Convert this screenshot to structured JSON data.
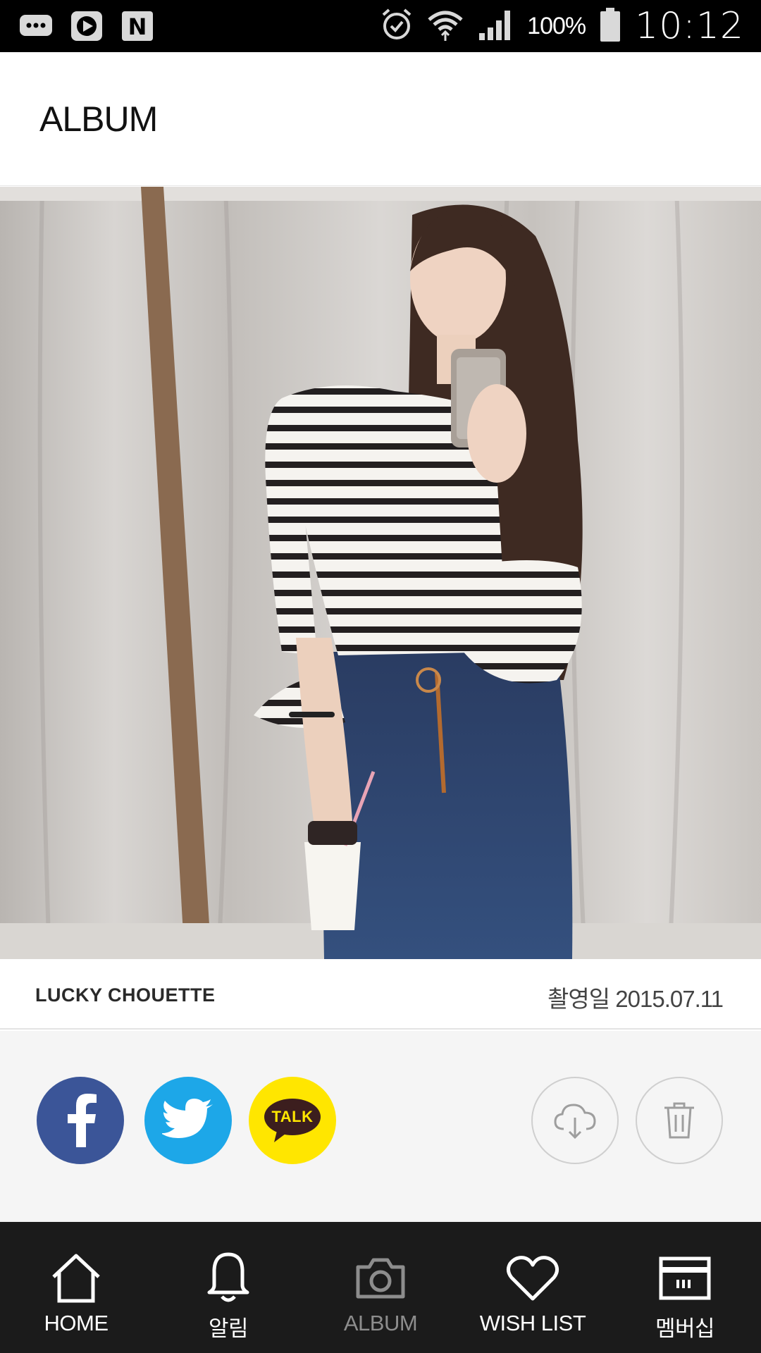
{
  "status_bar": {
    "icons": [
      "chat-bubble-icon",
      "play-icon",
      "naver-n-icon",
      "alarm-icon",
      "wifi-icon",
      "signal-icon",
      "battery-icon"
    ],
    "battery": "100%",
    "time": "10:12"
  },
  "header": {
    "title": "ALBUM"
  },
  "photo": {
    "description_icon": "photo-image"
  },
  "info": {
    "brand": "LUCKY CHOUETTE",
    "shoot_date": "촬영일 2015.07.11"
  },
  "share": {
    "facebook_icon": "facebook-icon",
    "twitter_icon": "twitter-icon",
    "kakaotalk_label": "TALK",
    "download_icon": "cloud-download-icon",
    "delete_icon": "trash-icon"
  },
  "colors": {
    "facebook": "#3b5598",
    "twitter": "#1da7e8",
    "kakaotalk": "#ffe600",
    "nav_bg": "#1b1b1b",
    "nav_active": "#8d8d8d"
  },
  "nav": {
    "items": [
      {
        "label": "HOME",
        "icon": "home-icon"
      },
      {
        "label": "알림",
        "icon": "bell-icon"
      },
      {
        "label": "ALBUM",
        "icon": "camera-icon",
        "active": true
      },
      {
        "label": "WISH LIST",
        "icon": "heart-icon"
      },
      {
        "label": "멤버십",
        "icon": "membership-card-icon"
      }
    ]
  }
}
